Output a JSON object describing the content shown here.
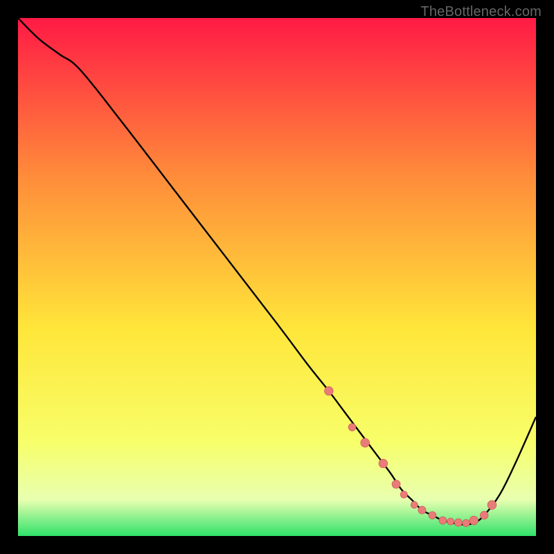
{
  "watermark": "TheBottleneck.com",
  "colors": {
    "bg_black": "#000000",
    "curve": "#000000",
    "marker_fill": "#e97b78",
    "marker_stroke": "#c85b58",
    "grad_top": "#ff1a45",
    "grad_mid_upper": "#ff8a3a",
    "grad_mid": "#ffe63a",
    "grad_mid_lower": "#f7ff6a",
    "grad_pale": "#e8ffb0",
    "grad_green": "#2fe26a"
  },
  "chart_data": {
    "type": "line",
    "title": "",
    "xlabel": "",
    "ylabel": "",
    "xlim": [
      0,
      100
    ],
    "ylim": [
      0,
      100
    ],
    "grid": false,
    "legend": false,
    "series": [
      {
        "name": "bottleneck-curve",
        "x": [
          0,
          4,
          8,
          12,
          20,
          30,
          40,
          50,
          56,
          60,
          63,
          66,
          69,
          72,
          74,
          76,
          78,
          80,
          82,
          84,
          86,
          88,
          90,
          93,
          96,
          100
        ],
        "y": [
          100,
          96,
          93,
          90,
          80,
          67,
          54,
          41,
          33,
          28,
          24,
          20,
          16,
          12,
          9,
          7,
          5,
          4,
          3,
          2.5,
          2.2,
          2.5,
          4,
          8,
          14,
          23
        ]
      }
    ],
    "markers": {
      "name": "highlight-points",
      "x": [
        60,
        64.5,
        67,
        70.5,
        73,
        74.5,
        76.5,
        78,
        80,
        82,
        83.5,
        85,
        86.5,
        88,
        90,
        91.5
      ],
      "y": [
        28,
        21,
        18,
        14,
        10,
        8,
        6,
        5,
        4,
        3,
        2.8,
        2.6,
        2.5,
        3,
        4,
        6
      ],
      "r": [
        6.3,
        5.4,
        6.4,
        6.3,
        6.0,
        5.1,
        5.0,
        5.6,
        5.4,
        5.5,
        5.0,
        5.6,
        5.2,
        6.3,
        5.8,
        6.4
      ]
    }
  }
}
